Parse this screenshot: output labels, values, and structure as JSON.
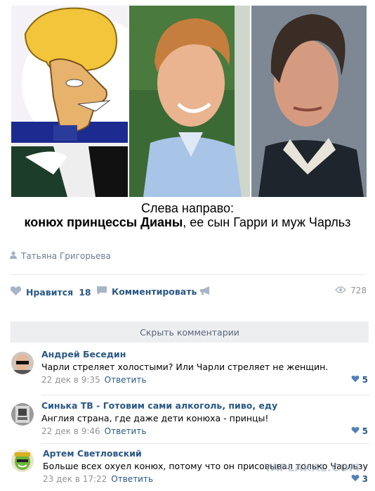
{
  "post": {
    "caption_line1": "Слева направо:",
    "caption_bold": "конюх принцессы Дианы",
    "caption_rest": ", ее сын Гарри и муж Чарльз",
    "author": "Татьяна Григорьева"
  },
  "actions": {
    "like_label": "Нравится",
    "like_count": "18",
    "comment_label": "Комментировать",
    "views": "728"
  },
  "comments_toggle": "Скрыть комментарии",
  "comments": [
    {
      "name": "Андрей Беседин",
      "text": "Чарли стреляет холостыми? Или Чарли стреляет не женщин.",
      "date": "22 дек в 9:35",
      "reply": "Ответить",
      "likes": "5"
    },
    {
      "name": "Синька ТВ - Готовим сами алкоголь, пиво, еду",
      "text": "Англия страна, где даже дети конюха - принцы!",
      "date": "22 дек в 9:46",
      "reply": "Ответить",
      "likes": "5"
    },
    {
      "name": "Артем Светловский",
      "text": "Больше всех охуел конюх, потому что он присовывал только Чарльзу",
      "date": "23 дек в 17:22",
      "reply": "Ответить",
      "likes": "3"
    }
  ],
  "watermark": "YAPLAKAL.COM",
  "colors": {
    "link": "#2a5885",
    "muted": "#939393",
    "divider": "#e7e8ec",
    "button_bg": "#edeef0"
  }
}
